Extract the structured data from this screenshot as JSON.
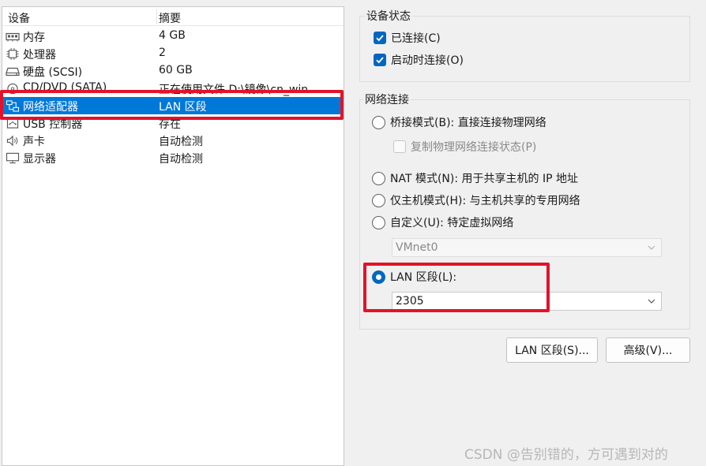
{
  "device_list": {
    "header": {
      "device": "设备",
      "summary": "摘要"
    },
    "rows": [
      {
        "icon": "memory-icon",
        "name": "内存",
        "summary": "4 GB"
      },
      {
        "icon": "processor-icon",
        "name": "处理器",
        "summary": "2"
      },
      {
        "icon": "hard-disk-icon",
        "name": "硬盘 (SCSI)",
        "summary": "60 GB"
      },
      {
        "icon": "cd-dvd-icon",
        "name": "CD/DVD (SATA)",
        "summary": "正在使用文件 D:\\镜像\\cn_win..."
      },
      {
        "icon": "network-adapter-icon",
        "name": "网络适配器",
        "summary": "LAN 区段",
        "selected": true
      },
      {
        "icon": "usb-controller-icon",
        "name": "USB 控制器",
        "summary": "存在"
      },
      {
        "icon": "sound-card-icon",
        "name": "声卡",
        "summary": "自动检测"
      },
      {
        "icon": "display-icon",
        "name": "显示器",
        "summary": "自动检测"
      }
    ]
  },
  "device_status": {
    "title": "设备状态",
    "connected": {
      "label": "已连接(C)",
      "checked": true
    },
    "connect_at_power_on": {
      "label": "启动时连接(O)",
      "checked": true
    }
  },
  "network_connection": {
    "title": "网络连接",
    "bridged": {
      "label": "桥接模式(B): 直接连接物理网络",
      "selected": false
    },
    "replicate_state": {
      "label": "复制物理网络连接状态(P)",
      "checked": false,
      "disabled": true
    },
    "nat": {
      "label": "NAT 模式(N): 用于共享主机的 IP 地址",
      "selected": false
    },
    "host_only": {
      "label": "仅主机模式(H): 与主机共享的专用网络",
      "selected": false
    },
    "custom": {
      "label": "自定义(U): 特定虚拟网络",
      "selected": false
    },
    "vmnet_dropdown": {
      "value": "VMnet0",
      "disabled": true
    },
    "lan_segment": {
      "label": "LAN 区段(L):",
      "selected": true
    },
    "lan_segment_dropdown": {
      "value": "2305"
    }
  },
  "buttons": {
    "lan_segments": "LAN 区段(S)...",
    "advanced": "高级(V)..."
  },
  "watermark": "CSDN @告别错的，方可遇到对的",
  "colors": {
    "accent": "#0067c0",
    "selection": "#0078d7",
    "highlight_box": "#e3122a"
  }
}
